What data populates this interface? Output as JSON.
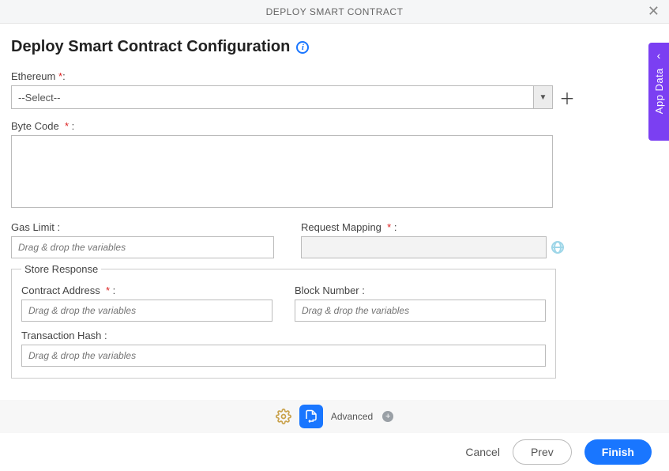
{
  "topbar": {
    "title": "DEPLOY SMART CONTRACT"
  },
  "page": {
    "title": "Deploy Smart Contract Configuration"
  },
  "sideTab": {
    "label": "App Data"
  },
  "fields": {
    "ethereum": {
      "label": "Ethereum",
      "selected": "--Select--"
    },
    "byteCode": {
      "label": "Byte Code",
      "value": ""
    },
    "gasLimit": {
      "label": "Gas Limit :",
      "placeholder": "Drag & drop the variables"
    },
    "requestMapping": {
      "label": "Request Mapping",
      "value": ""
    }
  },
  "storeResponse": {
    "legend": "Store Response",
    "contractAddress": {
      "label": "Contract Address",
      "placeholder": "Drag & drop the variables"
    },
    "blockNumber": {
      "label": "Block Number :",
      "placeholder": "Drag & drop the variables"
    },
    "transactionHash": {
      "label": "Transaction Hash :",
      "placeholder": "Drag & drop the variables"
    }
  },
  "toolbar": {
    "advanced": "Advanced"
  },
  "footer": {
    "cancel": "Cancel",
    "prev": "Prev",
    "finish": "Finish"
  }
}
